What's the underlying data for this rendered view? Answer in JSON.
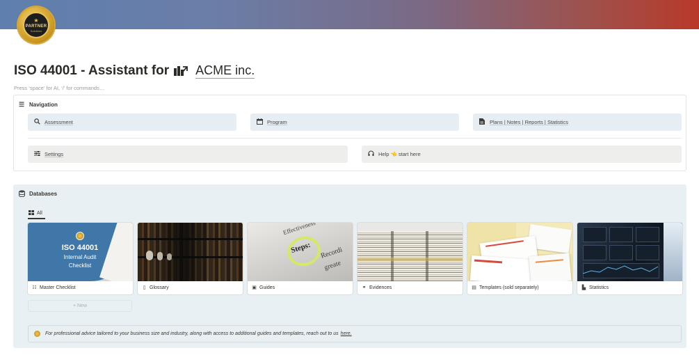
{
  "badge": {
    "text": "PARTNER",
    "sub": "Solutions"
  },
  "page": {
    "title": "ISO 44001 - Assistant for",
    "title_link": "ACME inc.",
    "hint": "Press ‘space’ for AI, ‘/’ for commands…"
  },
  "navigation": {
    "heading": "Navigation",
    "buttons": [
      {
        "label": "Assessment",
        "icon": "search-icon"
      },
      {
        "label": "Program",
        "icon": "calendar-icon"
      },
      {
        "label": "Plans | Notes | Reports | Statistics",
        "icon": "document-icon"
      },
      {
        "label": "Settings",
        "icon": "sliders-icon"
      },
      {
        "label": "Help 👈 start here",
        "icon": "headset-icon"
      }
    ]
  },
  "databases": {
    "heading": "Databases",
    "tab": "All",
    "cards": [
      {
        "label": "Master Checklist",
        "icon": "checklist-icon",
        "cover_title": "ISO 44001",
        "cover_sub1": "Internal Audit",
        "cover_sub2": "Checklist"
      },
      {
        "label": "Glossary",
        "icon": "page-icon"
      },
      {
        "label": "Guides",
        "icon": "book-icon"
      },
      {
        "label": "Evidences",
        "icon": "link-icon"
      },
      {
        "label": "Templates (sold separately)",
        "icon": "file-icon"
      },
      {
        "label": "Statistics",
        "icon": "bar-chart-icon"
      }
    ],
    "new_label": "+ New",
    "callout_text": "For professional advice tailored to your business size and industry, along with access to additional guides and templates, reach out to us",
    "callout_link": "here."
  },
  "colors": {
    "nav_blue": "#e6eef3",
    "nav_gray": "#eeeeec",
    "db_bg": "#e9f0f4"
  }
}
